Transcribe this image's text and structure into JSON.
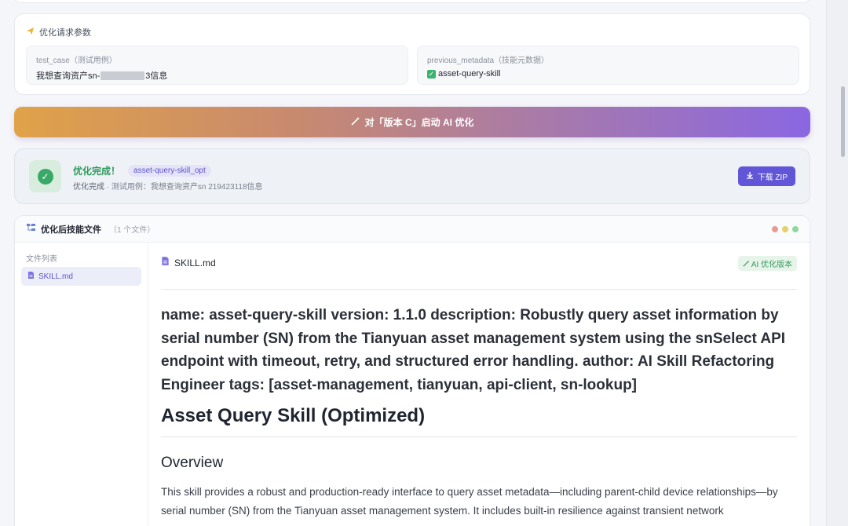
{
  "params": {
    "title": "优化请求参数",
    "test_case_label": "test_case（测试用例）",
    "test_case_value_prefix": "我想查询资产sn-",
    "test_case_value_suffix": "3信息",
    "metadata_label": "previous_metadata（技能元数据）",
    "metadata_value": "asset-query-skill"
  },
  "optimize_button": {
    "label": "对「版本 C」启动 AI 优化"
  },
  "result": {
    "title": "优化完成！",
    "skill_tag": "asset-query-skill_opt",
    "status": "优化完成",
    "detail": "· 测试用例：我想查询资产sn 219423118信息",
    "download_label": "下载 ZIP"
  },
  "files": {
    "title": "优化后技能文件",
    "count": "（1 个文件）",
    "list_label": "文件列表",
    "items": [
      {
        "label": "SKILL.md"
      }
    ]
  },
  "document": {
    "filename": "SKILL.md",
    "badge": "AI 优化版本",
    "frontmatter": "name: asset-query-skill version: 1.1.0 description: Robustly query asset information by serial number (SN) from the Tianyuan asset management system using the snSelect API endpoint with timeout, retry, and structured error handling. author: AI Skill Refactoring Engineer tags: [asset-management, tianyuan, api-client, sn-lookup]",
    "h1": "Asset Query Skill (Optimized)",
    "h2": "Overview",
    "paragraph": "This skill provides a robust and production-ready interface to query asset metadata—including parent-child device relationships—by serial number (SN) from the Tianyuan asset management system. It includes built-in resilience against transient network"
  },
  "colors": {
    "accent": "#6156d8",
    "success": "#3aa866",
    "window_dots": [
      "#e89a9a",
      "#e8cf6a",
      "#8fd6a0"
    ]
  }
}
